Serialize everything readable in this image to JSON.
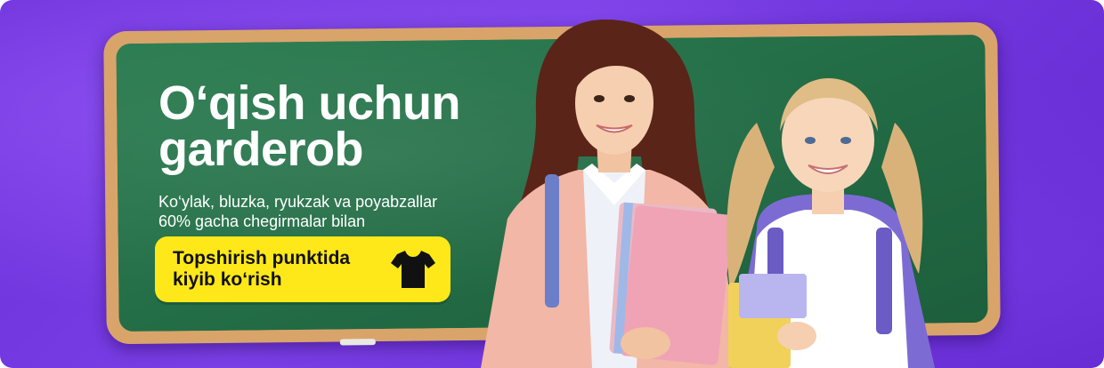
{
  "banner": {
    "headline_line1": "O‘qish uchun",
    "headline_line2": "garderob",
    "subtitle_line1": "Ko‘ylak, bluzka, ryukzak va poyabzallar",
    "subtitle_line2": "60% gacha chegirmalar bilan",
    "cta_line1": "Topshirish punktida",
    "cta_line2": "kiyib ko‘rish",
    "cta_icon": "tshirt-icon"
  },
  "colors": {
    "background": "#6a2ed8",
    "board_green": "#226b45",
    "board_frame": "#d9a46a",
    "cta_yellow": "#ffe81a"
  }
}
